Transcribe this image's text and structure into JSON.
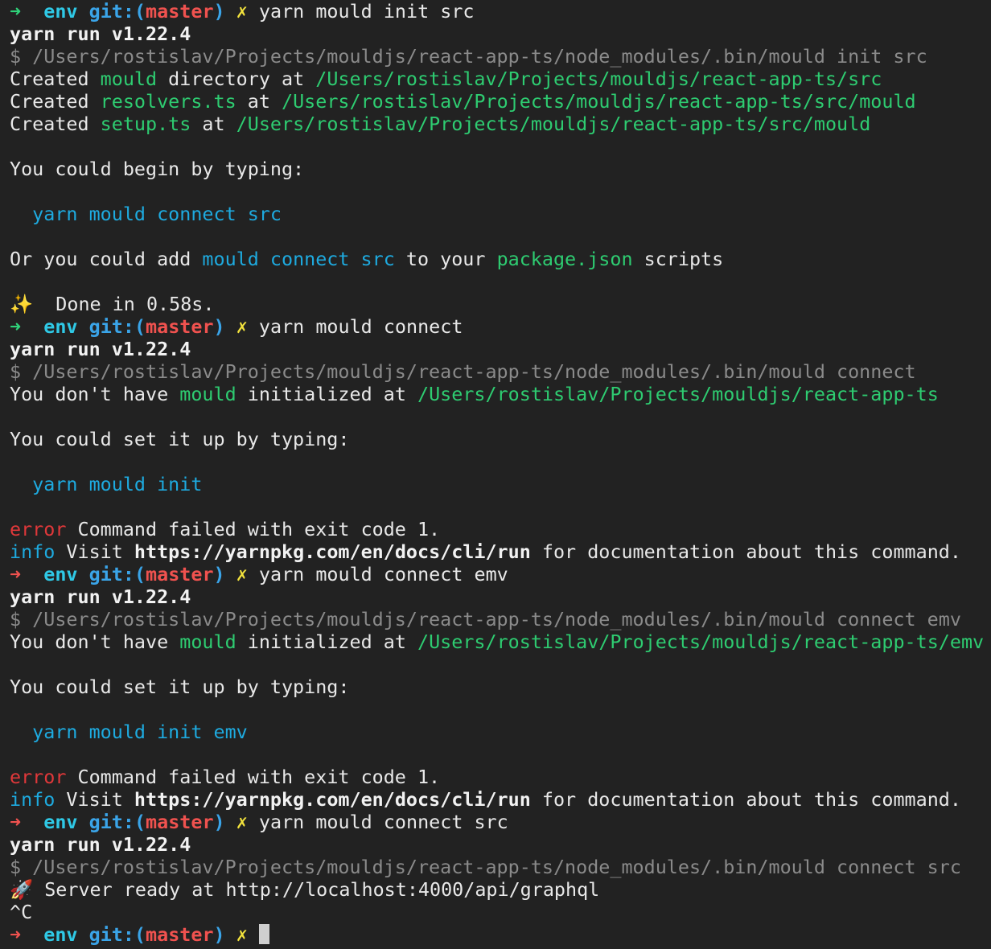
{
  "prompt": {
    "arrow": "➜",
    "dir": "env",
    "git_label": "git:",
    "open_paren": "(",
    "branch": "master",
    "close_paren": ")",
    "dirty": "✗"
  },
  "lines": [
    {
      "prompt": true,
      "arrow_color": "green",
      "cmd": "yarn mould init src"
    },
    {
      "segs": [
        {
          "t": "yarn run v1.22.4",
          "c": "bold"
        }
      ]
    },
    {
      "segs": [
        {
          "t": "$ /Users/rostislav/Projects/mouldjs/react-app-ts/node_modules/.bin/mould init src",
          "c": "dim"
        }
      ]
    },
    {
      "segs": [
        {
          "t": "Created ",
          "c": ""
        },
        {
          "t": "mould",
          "c": "green"
        },
        {
          "t": " directory at ",
          "c": ""
        },
        {
          "t": "/Users/rostislav/Projects/mouldjs/react-app-ts/src",
          "c": "green"
        }
      ]
    },
    {
      "segs": [
        {
          "t": "Created ",
          "c": ""
        },
        {
          "t": "resolvers.ts",
          "c": "green"
        },
        {
          "t": " at ",
          "c": ""
        },
        {
          "t": "/Users/rostislav/Projects/mouldjs/react-app-ts/src/mould",
          "c": "green"
        }
      ]
    },
    {
      "segs": [
        {
          "t": "Created ",
          "c": ""
        },
        {
          "t": "setup.ts",
          "c": "green"
        },
        {
          "t": " at ",
          "c": ""
        },
        {
          "t": "/Users/rostislav/Projects/mouldjs/react-app-ts/src/mould",
          "c": "green"
        }
      ]
    },
    {
      "segs": []
    },
    {
      "segs": [
        {
          "t": "You could begin by typing:",
          "c": ""
        }
      ]
    },
    {
      "segs": []
    },
    {
      "segs": [
        {
          "t": "  ",
          "c": ""
        },
        {
          "t": "yarn mould connect src",
          "c": "blue"
        }
      ]
    },
    {
      "segs": []
    },
    {
      "segs": [
        {
          "t": "Or you could add ",
          "c": ""
        },
        {
          "t": "mould connect src",
          "c": "blue"
        },
        {
          "t": " to your ",
          "c": ""
        },
        {
          "t": "package.json",
          "c": "green"
        },
        {
          "t": " scripts",
          "c": ""
        }
      ]
    },
    {
      "segs": []
    },
    {
      "segs": [
        {
          "t": "✨",
          "c": "sparkle"
        },
        {
          "t": "  Done in 0.58s.",
          "c": ""
        }
      ]
    },
    {
      "prompt": true,
      "arrow_color": "green",
      "cmd": "yarn mould connect"
    },
    {
      "segs": [
        {
          "t": "yarn run v1.22.4",
          "c": "bold"
        }
      ]
    },
    {
      "segs": [
        {
          "t": "$ /Users/rostislav/Projects/mouldjs/react-app-ts/node_modules/.bin/mould connect",
          "c": "dim"
        }
      ]
    },
    {
      "segs": [
        {
          "t": "You don't have ",
          "c": ""
        },
        {
          "t": "mould",
          "c": "green"
        },
        {
          "t": " initialized at ",
          "c": ""
        },
        {
          "t": "/Users/rostislav/Projects/mouldjs/react-app-ts",
          "c": "green"
        }
      ]
    },
    {
      "segs": []
    },
    {
      "segs": [
        {
          "t": "You could set it up by typing:",
          "c": ""
        }
      ]
    },
    {
      "segs": []
    },
    {
      "segs": [
        {
          "t": "  ",
          "c": ""
        },
        {
          "t": "yarn mould init",
          "c": "blue"
        }
      ]
    },
    {
      "segs": []
    },
    {
      "segs": [
        {
          "t": "error",
          "c": "red"
        },
        {
          "t": " Command failed with exit code 1.",
          "c": ""
        }
      ]
    },
    {
      "segs": [
        {
          "t": "info",
          "c": "blue"
        },
        {
          "t": " Visit ",
          "c": ""
        },
        {
          "t": "https://yarnpkg.com/en/docs/cli/run",
          "c": "bold"
        },
        {
          "t": " for documentation about this command.",
          "c": ""
        }
      ]
    },
    {
      "prompt": true,
      "arrow_color": "red",
      "cmd": "yarn mould connect emv"
    },
    {
      "segs": [
        {
          "t": "yarn run v1.22.4",
          "c": "bold"
        }
      ]
    },
    {
      "segs": [
        {
          "t": "$ /Users/rostislav/Projects/mouldjs/react-app-ts/node_modules/.bin/mould connect emv",
          "c": "dim"
        }
      ]
    },
    {
      "segs": [
        {
          "t": "You don't have ",
          "c": ""
        },
        {
          "t": "mould",
          "c": "green"
        },
        {
          "t": " initialized at ",
          "c": ""
        },
        {
          "t": "/Users/rostislav/Projects/mouldjs/react-app-ts/emv",
          "c": "green"
        }
      ]
    },
    {
      "segs": []
    },
    {
      "segs": [
        {
          "t": "You could set it up by typing:",
          "c": ""
        }
      ]
    },
    {
      "segs": []
    },
    {
      "segs": [
        {
          "t": "  ",
          "c": ""
        },
        {
          "t": "yarn mould init emv",
          "c": "blue"
        }
      ]
    },
    {
      "segs": []
    },
    {
      "segs": [
        {
          "t": "error",
          "c": "red"
        },
        {
          "t": " Command failed with exit code 1.",
          "c": ""
        }
      ]
    },
    {
      "segs": [
        {
          "t": "info",
          "c": "blue"
        },
        {
          "t": " Visit ",
          "c": ""
        },
        {
          "t": "https://yarnpkg.com/en/docs/cli/run",
          "c": "bold"
        },
        {
          "t": " for documentation about this command.",
          "c": ""
        }
      ]
    },
    {
      "prompt": true,
      "arrow_color": "red",
      "cmd": "yarn mould connect src"
    },
    {
      "segs": [
        {
          "t": "yarn run v1.22.4",
          "c": "bold"
        }
      ]
    },
    {
      "segs": [
        {
          "t": "$ /Users/rostislav/Projects/mouldjs/react-app-ts/node_modules/.bin/mould connect src",
          "c": "dim"
        }
      ]
    },
    {
      "segs": [
        {
          "t": "🚀",
          "c": ""
        },
        {
          "t": " Server ready at http://localhost:4000/api/graphql",
          "c": ""
        }
      ]
    },
    {
      "segs": [
        {
          "t": "^C",
          "c": ""
        }
      ]
    },
    {
      "prompt": true,
      "arrow_color": "red",
      "cmd": "",
      "cursor": true
    }
  ],
  "colors": {
    "background": "#222222",
    "green": "#2ecc71",
    "blue": "#1eaadf",
    "red": "#e0383a",
    "dim": "#8a8a8a",
    "yellow": "#f2e23d"
  }
}
